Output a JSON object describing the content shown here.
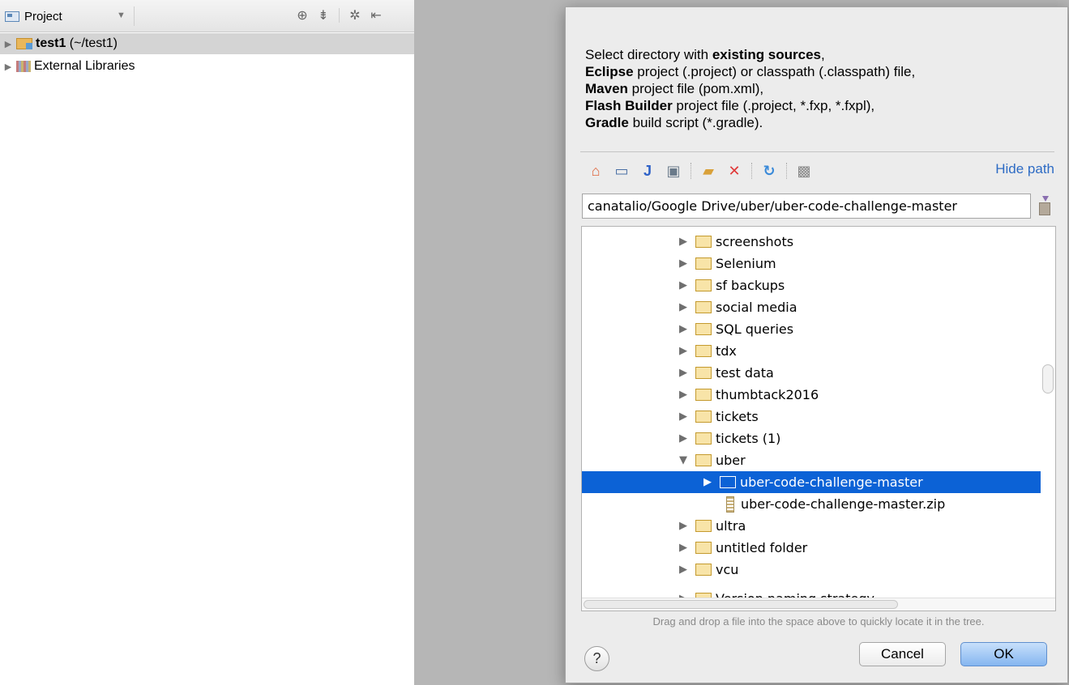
{
  "project_pane": {
    "view_label": "Project",
    "items": [
      {
        "name": "test1",
        "path": " (~/test1)"
      },
      {
        "name": "External Libraries"
      }
    ]
  },
  "dialog": {
    "description": [
      {
        "bold": "",
        "rest": "Select directory with "
      },
      {
        "bold": "existing sources",
        "rest": ","
      },
      {
        "bold": "Eclipse",
        "rest": " project (.project) or classpath (.classpath) file,"
      },
      {
        "bold": "Maven",
        "rest": " project file (pom.xml),"
      },
      {
        "bold": "Flash Builder",
        "rest": " project file (.project, *.fxp, *.fxpl),"
      },
      {
        "bold": "Gradle",
        "rest": " build script (*.gradle)."
      }
    ],
    "hide_path": "Hide path",
    "path_value": "canatalio/Google Drive/uber/uber-code-challenge-master",
    "tree": [
      {
        "label": "screenshots"
      },
      {
        "label": "Selenium"
      },
      {
        "label": "sf backups"
      },
      {
        "label": "social media"
      },
      {
        "label": "SQL queries"
      },
      {
        "label": "tdx"
      },
      {
        "label": "test data"
      },
      {
        "label": "thumbtack2016"
      },
      {
        "label": "tickets"
      },
      {
        "label": "tickets (1)"
      },
      {
        "label": "uber"
      },
      {
        "label": "uber-code-challenge-master"
      },
      {
        "label": "uber-code-challenge-master.zip"
      },
      {
        "label": "ultra"
      },
      {
        "label": "untitled folder"
      },
      {
        "label": "vcu"
      },
      {
        "label": "Version naming strategy"
      }
    ],
    "hint": "Drag and drop a file into the space above to quickly locate it in the tree.",
    "help_label": "?",
    "cancel_label": "Cancel",
    "ok_label": "OK"
  }
}
